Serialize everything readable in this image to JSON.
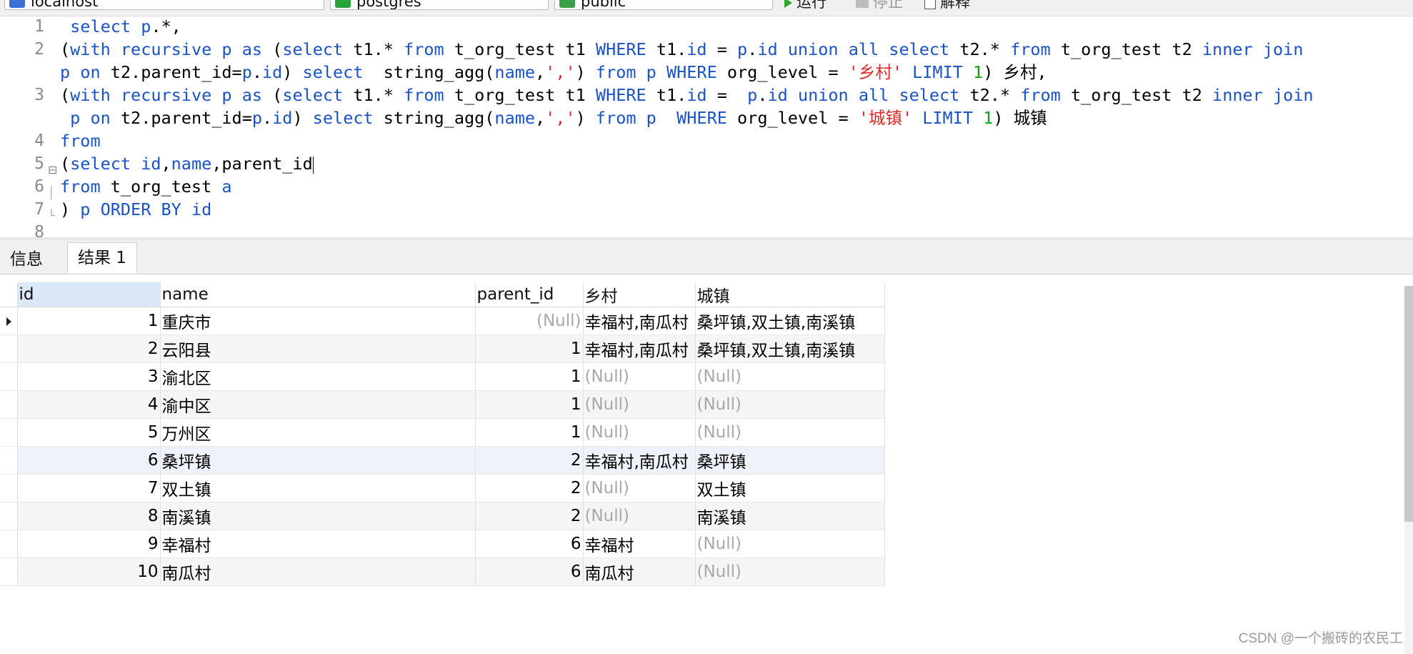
{
  "toolbar": {
    "connection": "localhost",
    "database": "postgres",
    "schema": "public",
    "run_label": "运行",
    "stop_label": "停止",
    "explain_label": "解释"
  },
  "editor": {
    "line_numbers": [
      "1",
      "2",
      "",
      "3",
      "",
      "4",
      "5",
      "6",
      "7",
      "8"
    ],
    "lines": [
      [
        {
          "t": " "
        },
        {
          "t": "select",
          "c": "kw"
        },
        {
          "t": " "
        },
        {
          "t": "p",
          "c": "kw"
        },
        {
          "t": ".*,"
        }
      ],
      [
        {
          "t": "("
        },
        {
          "t": "with",
          "c": "kw"
        },
        {
          "t": " "
        },
        {
          "t": "recursive",
          "c": "kw"
        },
        {
          "t": " "
        },
        {
          "t": "p",
          "c": "kw"
        },
        {
          "t": " "
        },
        {
          "t": "as",
          "c": "kw"
        },
        {
          "t": " ("
        },
        {
          "t": "select",
          "c": "kw"
        },
        {
          "t": " t1.* "
        },
        {
          "t": "from",
          "c": "kw"
        },
        {
          "t": " t_org_test t1 "
        },
        {
          "t": "WHERE",
          "c": "kw"
        },
        {
          "t": " t1."
        },
        {
          "t": "id",
          "c": "kw"
        },
        {
          "t": " = "
        },
        {
          "t": "p",
          "c": "kw"
        },
        {
          "t": "."
        },
        {
          "t": "id",
          "c": "kw"
        },
        {
          "t": " "
        },
        {
          "t": "union",
          "c": "kw"
        },
        {
          "t": " "
        },
        {
          "t": "all",
          "c": "kw"
        },
        {
          "t": " "
        },
        {
          "t": "select",
          "c": "kw"
        },
        {
          "t": " t2.* "
        },
        {
          "t": "from",
          "c": "kw"
        },
        {
          "t": " t_org_test t2 "
        },
        {
          "t": "inner",
          "c": "kw"
        },
        {
          "t": " "
        },
        {
          "t": "join",
          "c": "kw"
        }
      ],
      [
        {
          "t": "p",
          "c": "kw"
        },
        {
          "t": " "
        },
        {
          "t": "on",
          "c": "kw"
        },
        {
          "t": " t2.parent_id="
        },
        {
          "t": "p",
          "c": "kw"
        },
        {
          "t": "."
        },
        {
          "t": "id",
          "c": "kw"
        },
        {
          "t": ") "
        },
        {
          "t": "select",
          "c": "kw"
        },
        {
          "t": "  string_agg("
        },
        {
          "t": "name",
          "c": "kw"
        },
        {
          "t": ","
        },
        {
          "t": "','",
          "c": "st"
        },
        {
          "t": ") "
        },
        {
          "t": "from",
          "c": "kw"
        },
        {
          "t": " "
        },
        {
          "t": "p",
          "c": "kw"
        },
        {
          "t": " "
        },
        {
          "t": "WHERE",
          "c": "kw"
        },
        {
          "t": " org_level = "
        },
        {
          "t": "'乡村'",
          "c": "st"
        },
        {
          "t": " "
        },
        {
          "t": "LIMIT",
          "c": "kw"
        },
        {
          "t": " "
        },
        {
          "t": "1",
          "c": "nm"
        },
        {
          "t": ") 乡村,"
        }
      ],
      [
        {
          "t": "("
        },
        {
          "t": "with",
          "c": "kw"
        },
        {
          "t": " "
        },
        {
          "t": "recursive",
          "c": "kw"
        },
        {
          "t": " "
        },
        {
          "t": "p",
          "c": "kw"
        },
        {
          "t": " "
        },
        {
          "t": "as",
          "c": "kw"
        },
        {
          "t": " ("
        },
        {
          "t": "select",
          "c": "kw"
        },
        {
          "t": " t1.* "
        },
        {
          "t": "from",
          "c": "kw"
        },
        {
          "t": " t_org_test t1 "
        },
        {
          "t": "WHERE",
          "c": "kw"
        },
        {
          "t": " t1."
        },
        {
          "t": "id",
          "c": "kw"
        },
        {
          "t": " =  "
        },
        {
          "t": "p",
          "c": "kw"
        },
        {
          "t": "."
        },
        {
          "t": "id",
          "c": "kw"
        },
        {
          "t": " "
        },
        {
          "t": "union",
          "c": "kw"
        },
        {
          "t": " "
        },
        {
          "t": "all",
          "c": "kw"
        },
        {
          "t": " "
        },
        {
          "t": "select",
          "c": "kw"
        },
        {
          "t": " t2.* "
        },
        {
          "t": "from",
          "c": "kw"
        },
        {
          "t": " t_org_test t2 "
        },
        {
          "t": "inner",
          "c": "kw"
        },
        {
          "t": " "
        },
        {
          "t": "join",
          "c": "kw"
        }
      ],
      [
        {
          "t": " "
        },
        {
          "t": "p",
          "c": "kw"
        },
        {
          "t": " "
        },
        {
          "t": "on",
          "c": "kw"
        },
        {
          "t": " t2.parent_id="
        },
        {
          "t": "p",
          "c": "kw"
        },
        {
          "t": "."
        },
        {
          "t": "id",
          "c": "kw"
        },
        {
          "t": ") "
        },
        {
          "t": "select",
          "c": "kw"
        },
        {
          "t": " string_agg("
        },
        {
          "t": "name",
          "c": "kw"
        },
        {
          "t": ","
        },
        {
          "t": "','",
          "c": "st"
        },
        {
          "t": ") "
        },
        {
          "t": "from",
          "c": "kw"
        },
        {
          "t": " "
        },
        {
          "t": "p",
          "c": "kw"
        },
        {
          "t": "  "
        },
        {
          "t": "WHERE",
          "c": "kw"
        },
        {
          "t": " org_level = "
        },
        {
          "t": "'城镇'",
          "c": "st"
        },
        {
          "t": " "
        },
        {
          "t": "LIMIT",
          "c": "kw"
        },
        {
          "t": " "
        },
        {
          "t": "1",
          "c": "nm"
        },
        {
          "t": ") 城镇"
        }
      ],
      [
        {
          "t": "from",
          "c": "kw"
        }
      ],
      [
        {
          "t": "("
        },
        {
          "t": "select",
          "c": "kw"
        },
        {
          "t": " "
        },
        {
          "t": "id",
          "c": "kw"
        },
        {
          "t": ","
        },
        {
          "t": "name",
          "c": "kw"
        },
        {
          "t": ",parent_id"
        }
      ],
      [
        {
          "t": "from",
          "c": "kw"
        },
        {
          "t": " t_org_test "
        },
        {
          "t": "a",
          "c": "kw"
        }
      ],
      [
        {
          "t": ") "
        },
        {
          "t": "p",
          "c": "kw"
        },
        {
          "t": " "
        },
        {
          "t": "ORDER",
          "c": "kw"
        },
        {
          "t": " "
        },
        {
          "t": "BY",
          "c": "kw"
        },
        {
          "t": " "
        },
        {
          "t": "id",
          "c": "kw"
        }
      ],
      []
    ]
  },
  "tabs": [
    "信息",
    "结果 1"
  ],
  "grid": {
    "columns": [
      "id",
      "name",
      "parent_id",
      "乡村",
      "城镇"
    ],
    "rows": [
      [
        "1",
        "重庆市",
        "(Null)",
        "幸福村,南瓜村",
        "桑坪镇,双土镇,南溪镇"
      ],
      [
        "2",
        "云阳县",
        "1",
        "幸福村,南瓜村",
        "桑坪镇,双土镇,南溪镇"
      ],
      [
        "3",
        "渝北区",
        "1",
        "(Null)",
        "(Null)"
      ],
      [
        "4",
        "渝中区",
        "1",
        "(Null)",
        "(Null)"
      ],
      [
        "5",
        "万州区",
        "1",
        "(Null)",
        "(Null)"
      ],
      [
        "6",
        "桑坪镇",
        "2",
        "幸福村,南瓜村",
        "桑坪镇"
      ],
      [
        "7",
        "双土镇",
        "2",
        "(Null)",
        "双土镇"
      ],
      [
        "8",
        "南溪镇",
        "2",
        "(Null)",
        "南溪镇"
      ],
      [
        "9",
        "幸福村",
        "6",
        "幸福村",
        "(Null)"
      ],
      [
        "10",
        "南瓜村",
        "6",
        "南瓜村",
        "(Null)"
      ]
    ]
  },
  "watermark": "CSDN @一个搬砖的农民工"
}
